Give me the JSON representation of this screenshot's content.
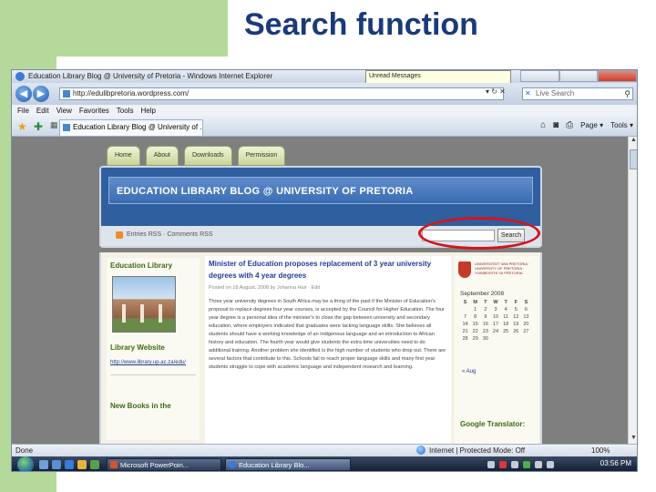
{
  "slide": {
    "title": "Search function"
  },
  "browser": {
    "window_title": "Education Library Blog @ University of Pretoria - Windows Internet Explorer",
    "tooltip": "Unread Messages",
    "address": "http://edulibpretoria.wordpress.com/",
    "search_placeholder": "Live Search",
    "menu": [
      "File",
      "Edit",
      "View",
      "Favorites",
      "Tools",
      "Help"
    ],
    "tab_label": "Education Library Blog @ University of ...",
    "cmd_page": "Page ▾",
    "cmd_tools": "Tools ▾",
    "status_done": "Done",
    "status_zone": "Internet | Protected Mode: Off",
    "zoom": "100%"
  },
  "blog": {
    "nav_tabs": [
      "Home",
      "About",
      "Downloads",
      "Permission"
    ],
    "title": "EDUCATION LIBRARY BLOG @ UNIVERSITY OF PRETORIA",
    "feeds_text": "Entries RSS · Comments RSS",
    "search_button": "Search",
    "left": {
      "heading_1": "Education Library",
      "heading_2": "Library Website",
      "link": "http://www.library.up.ac.za/edu/",
      "heading_3": "New Books in the"
    },
    "post": {
      "title": "Minister of Education proposes replacement of 3 year university degrees with 4 year degrees",
      "meta": "Posted on 18 August, 2008 by Johanna Hair · Edit",
      "text": "Three year university degrees in South Africa may be a thing of the past if the Minister of Education's proposal to replace degrees four year courses, is accepted by the Council for Higher Education. The four year degree is a personal idea of the minister's to close the gap between university and secondary education, where employers indicated that graduates were lacking language skills. She believes all students should have a working knowledge of an indigenous language and an introduction to African history and education. The fourth year would give students the extra time universities need to do additional training. Another problem she identified is the high number of students who drop out. There are several factors that contribute to this. Schools fail to reach proper language skills and many first year students struggle to cope with academic language and independent research and learning."
    },
    "right": {
      "crest_text": "UNIVERSITEIT VAN PRETORIA · UNIVERSITY OF PRETORIA · YUNIBESITHI YA PRETORIA",
      "calendar_title": "September 2008",
      "calendar_headers": [
        "S",
        "M",
        "T",
        "W",
        "T",
        "F",
        "S"
      ],
      "calendar_days": [
        "",
        "1",
        "2",
        "3",
        "4",
        "5",
        "6",
        "7",
        "8",
        "9",
        "10",
        "11",
        "12",
        "13",
        "14",
        "15",
        "16",
        "17",
        "18",
        "19",
        "20",
        "21",
        "22",
        "23",
        "24",
        "25",
        "26",
        "27",
        "28",
        "29",
        "30",
        "",
        "",
        "",
        ""
      ],
      "calendar_prev": "« Aug",
      "google_translator": "Google Translator:"
    }
  },
  "taskbar": {
    "buttons": [
      "Microsoft PowerPoin...",
      "Education Library Blo..."
    ],
    "clock": "03:56 PM"
  }
}
